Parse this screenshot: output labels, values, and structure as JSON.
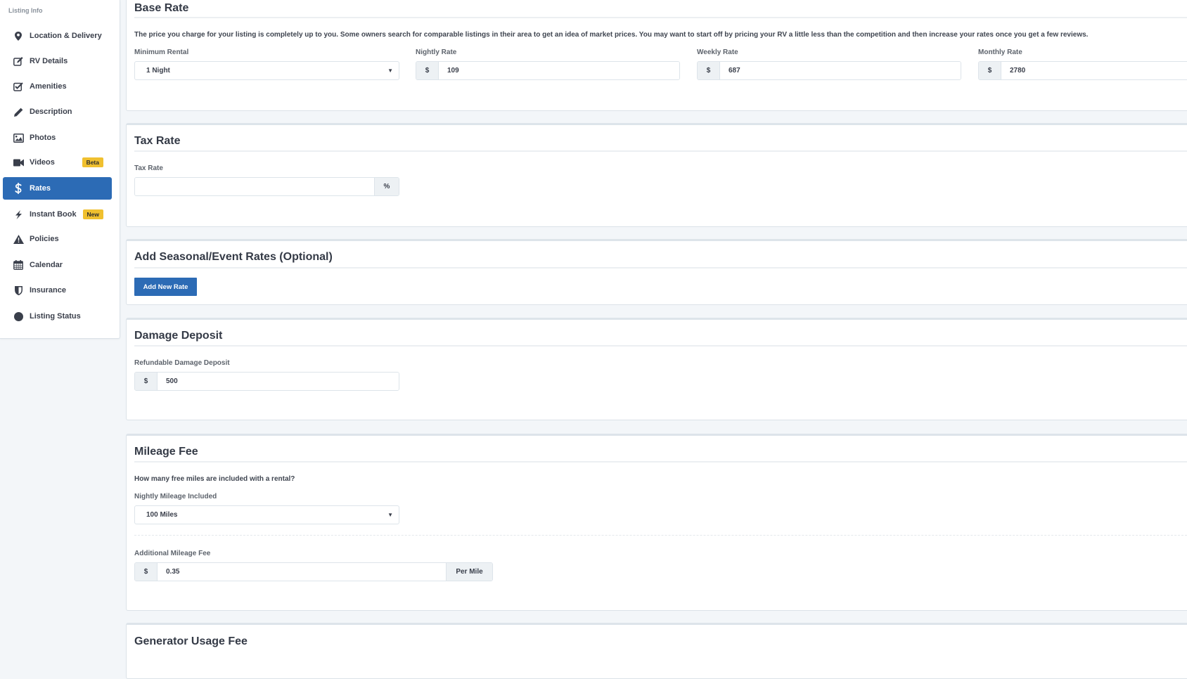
{
  "sidebar": {
    "heading": "Listing Info",
    "items": [
      {
        "label": "Location & Delivery",
        "icon": "map-pin-icon",
        "active": false
      },
      {
        "label": "RV Details",
        "icon": "edit-icon",
        "active": false
      },
      {
        "label": "Amenities",
        "icon": "checkbox-icon",
        "active": false
      },
      {
        "label": "Description",
        "icon": "pencil-icon",
        "active": false
      },
      {
        "label": "Photos",
        "icon": "image-icon",
        "active": false
      },
      {
        "label": "Videos",
        "icon": "video-camera-icon",
        "active": false,
        "badge": "Beta"
      },
      {
        "label": "Rates",
        "icon": "dollar-icon",
        "active": true
      },
      {
        "label": "Instant Book",
        "icon": "lightning-icon",
        "active": false,
        "badge": "New"
      },
      {
        "label": "Policies",
        "icon": "warning-icon",
        "active": false
      },
      {
        "label": "Calendar",
        "icon": "calendar-icon",
        "active": false
      },
      {
        "label": "Insurance",
        "icon": "shield-icon",
        "active": false
      },
      {
        "label": "Listing Status",
        "icon": "circle-icon",
        "active": false
      }
    ]
  },
  "colors": {
    "accent": "#2c6bb5",
    "badge": "#f0c02f",
    "background": "#f3f6f9"
  },
  "base_rate": {
    "title": "Base Rate",
    "description": "The price you charge for your listing is completely up to you. Some owners search for comparable listings in their area to get an idea of market prices. You may want to start off by pricing your RV a little less than the competition and then increase your rates once you get a few reviews.",
    "minimum_rental": {
      "label": "Minimum Rental",
      "value": "1 Night"
    },
    "nightly": {
      "label": "Nightly Rate",
      "prefix": "$",
      "value": "109"
    },
    "weekly": {
      "label": "Weekly Rate",
      "prefix": "$",
      "value": "687"
    },
    "monthly": {
      "label": "Monthly Rate",
      "prefix": "$",
      "value": "2780"
    }
  },
  "tax_rate": {
    "title": "Tax Rate",
    "label": "Tax Rate",
    "value": "",
    "suffix": "%"
  },
  "seasonal": {
    "title": "Add Seasonal/Event Rates (Optional)",
    "button": "Add New Rate"
  },
  "damage_deposit": {
    "title": "Damage Deposit",
    "label": "Refundable Damage Deposit",
    "prefix": "$",
    "value": "500"
  },
  "mileage": {
    "title": "Mileage Fee",
    "question": "How many free miles are included with a rental?",
    "included": {
      "label": "Nightly Mileage Included",
      "value": "100 Miles"
    },
    "additional": {
      "label": "Additional Mileage Fee",
      "prefix": "$",
      "value": "0.35",
      "suffix": "Per Mile"
    }
  },
  "generator": {
    "title": "Generator Usage Fee"
  }
}
